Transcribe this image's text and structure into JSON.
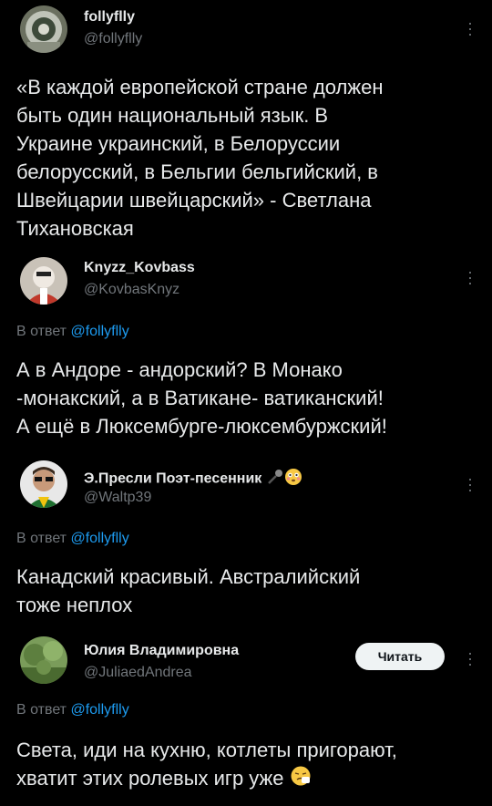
{
  "posts": [
    {
      "name": "follyflly",
      "handle": "@follyflly",
      "text_lines": [
        "«В каждой европейской стране должен",
        "быть один национальный язык. В",
        "Украине украинский, в Белоруссии",
        "белорусский, в Бельгии бельгийский, в",
        "Швейцарии швейцарский» - Светлана",
        "Тихановская"
      ]
    },
    {
      "name": "Knyzz_Kovbass",
      "handle": "@KovbasKnyz",
      "reply_prefix": "В ответ",
      "reply_to": "@follyflly",
      "text_lines": [
        "А в Андоре - андорский? В Монако",
        "-монакский, а в Ватикане- ватиканский!",
        "А ещё в Люксембурге-люксембуржский!"
      ]
    },
    {
      "name": "Э.Пресли Поэт-песенник",
      "handle": "@Waltp39",
      "reply_prefix": "В ответ",
      "reply_to": "@follyflly",
      "text_lines": [
        "Канадский красивый. Австралийский",
        "тоже неплох"
      ]
    },
    {
      "name": "Юлия Владимировна",
      "handle": "@JuliaedAndrea",
      "follow_label": "Читать",
      "reply_prefix": "В ответ",
      "reply_to": "@follyflly",
      "text_lines": [
        "Света, иди на кухню, котлеты пригорают,",
        "хватит этих ролевых игр уже"
      ]
    }
  ],
  "icons": {
    "more": "more-vertical-icon",
    "microphone": "microphone-emoji",
    "flushed": "flushed-face-emoji",
    "sneezing": "sneezing-face-emoji"
  }
}
